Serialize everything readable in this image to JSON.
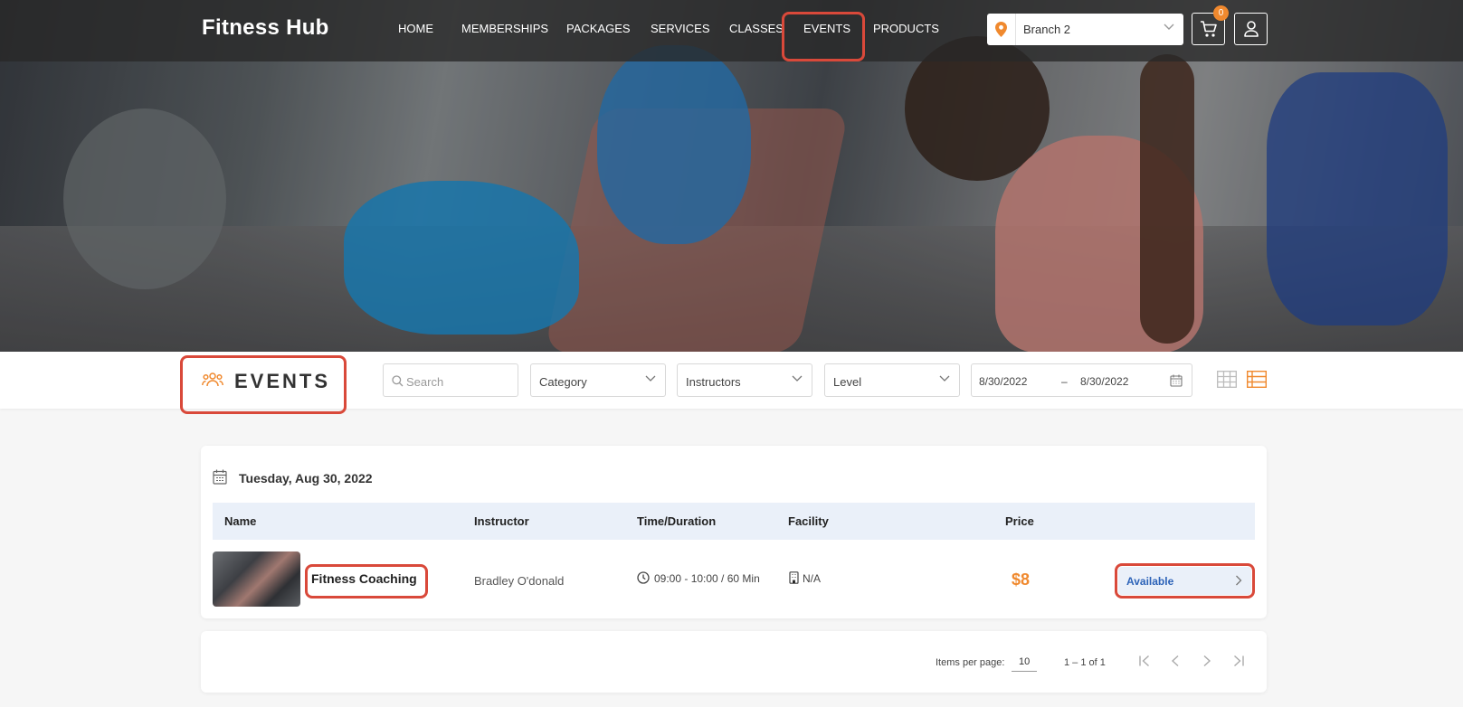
{
  "app": {
    "brand": "Fitness Hub"
  },
  "nav": {
    "items": [
      {
        "label": "HOME"
      },
      {
        "label": "MEMBERSHIPS"
      },
      {
        "label": "PACKAGES"
      },
      {
        "label": "SERVICES"
      },
      {
        "label": "CLASSES"
      },
      {
        "label": "EVENTS",
        "active": true
      },
      {
        "label": "PRODUCTS"
      }
    ],
    "branch": "Branch 2",
    "cart_count": "0"
  },
  "page": {
    "title": "EVENTS"
  },
  "filters": {
    "search_placeholder": "Search",
    "category": "Category",
    "instructors": "Instructors",
    "level": "Level",
    "date_from": "8/30/2022",
    "date_sep": "–",
    "date_to": "8/30/2022"
  },
  "schedule": {
    "date": "Tuesday, Aug 30, 2022",
    "columns": [
      "Name",
      "Instructor",
      "Time/Duration",
      "Facility",
      "Price"
    ],
    "rows": [
      {
        "name": "Fitness Coaching",
        "instructor": "Bradley O'donald",
        "time": "09:00 - 10:00 / 60 Min",
        "facility": "N/A",
        "price": "$8",
        "status": "Available"
      }
    ]
  },
  "paginator": {
    "items_per_page_label": "Items per page:",
    "items_per_page": "10",
    "range": "1 – 1 of 1"
  },
  "colors": {
    "accent": "#f0892e",
    "highlight": "#d9493a",
    "link": "#2d63b8",
    "header_row": "#eaf0f9"
  }
}
